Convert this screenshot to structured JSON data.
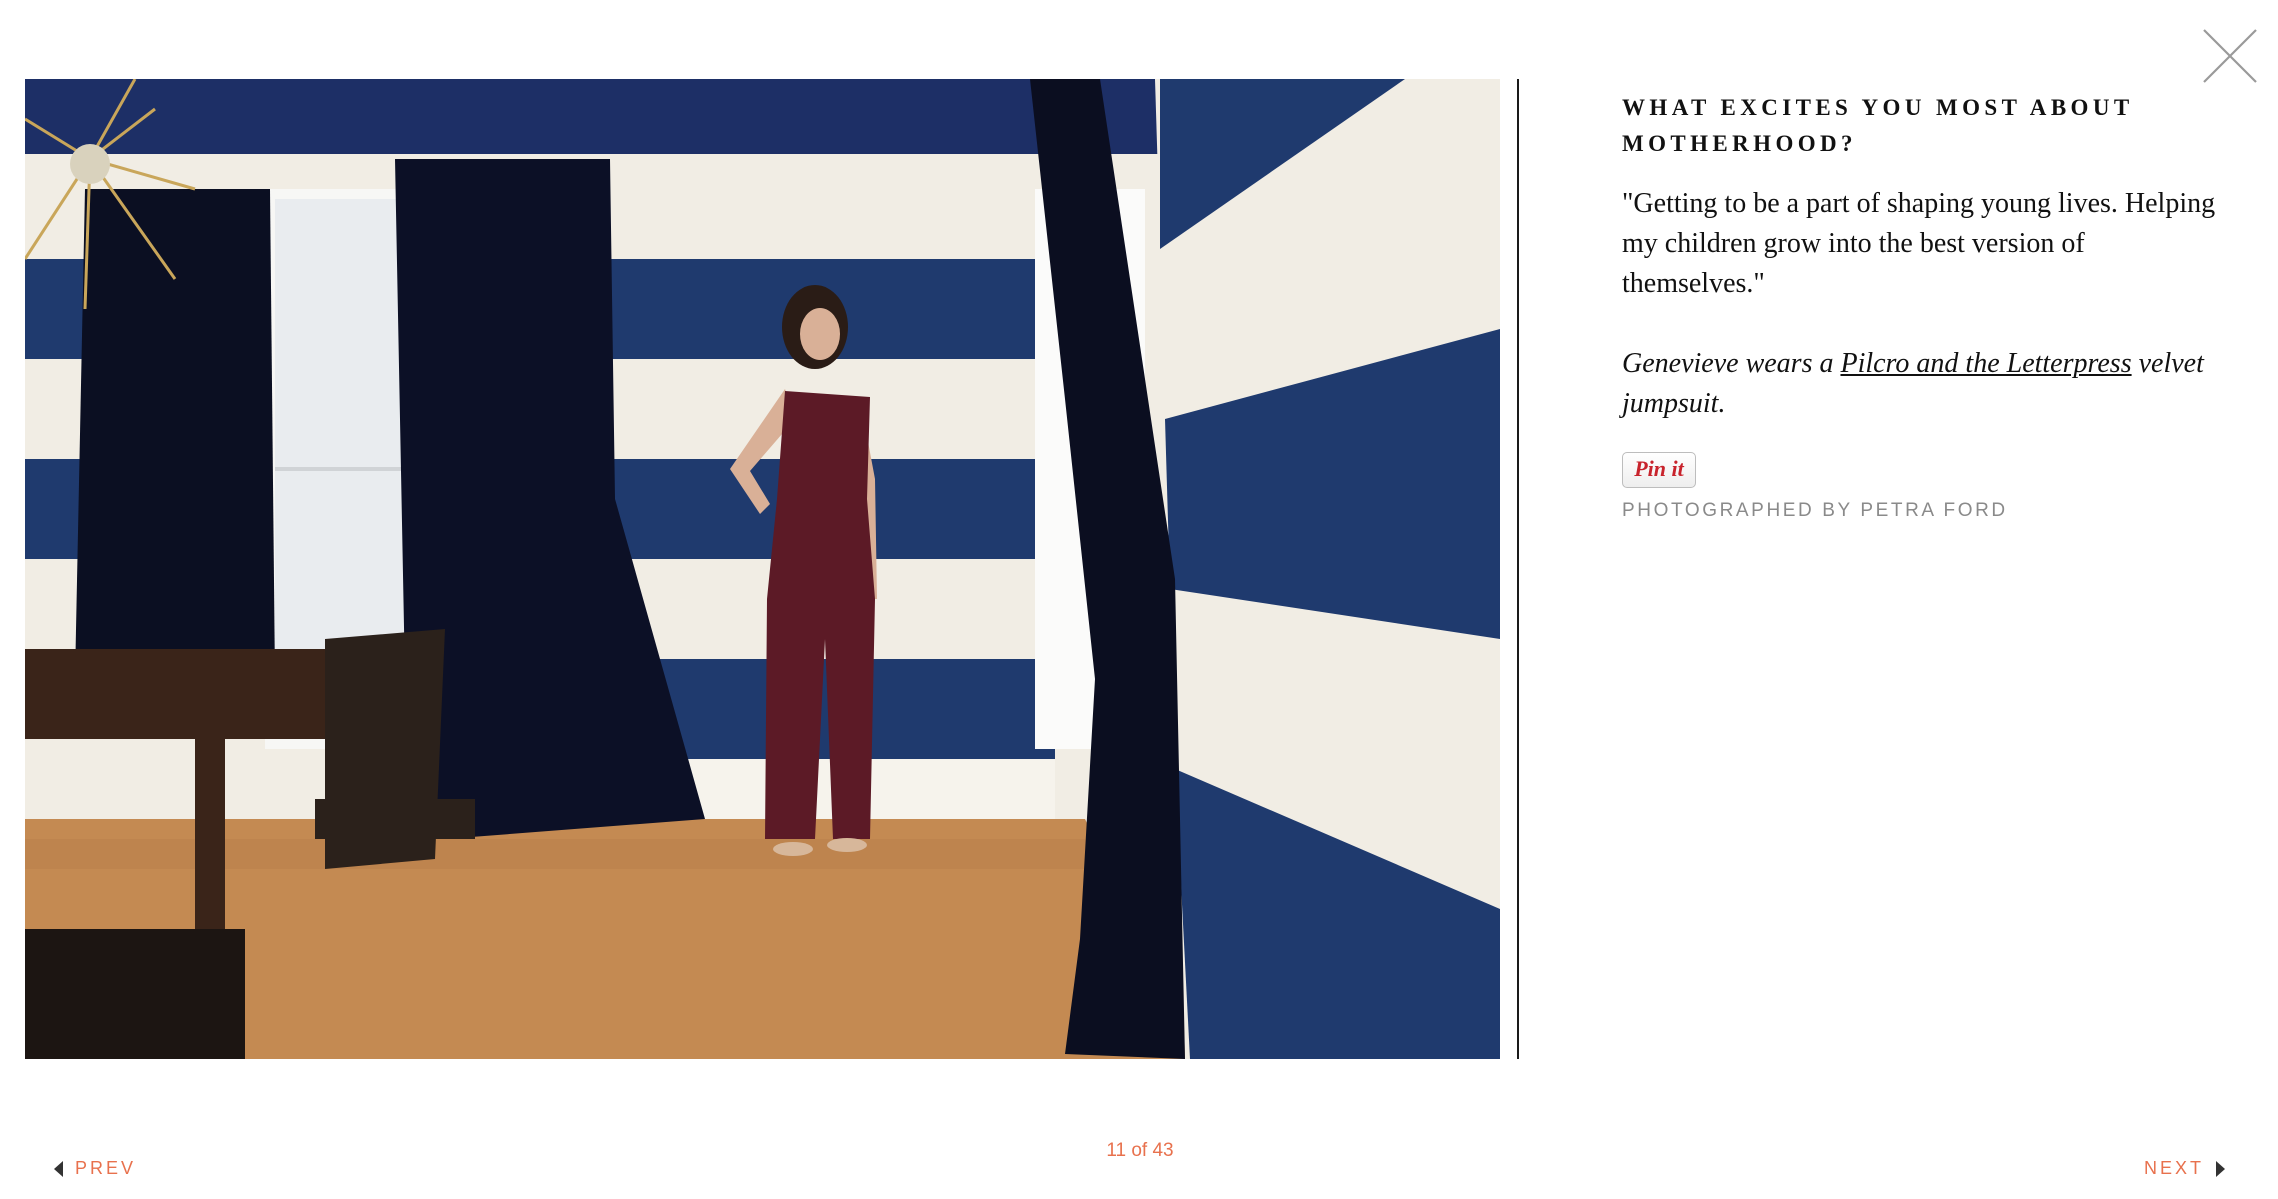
{
  "article": {
    "question": "WHAT EXCITES YOU MOST ABOUT MOTHERHOOD?",
    "answer": "\"Getting to be a part of shaping young lives. Helping my children grow into the best version of themselves.\"",
    "credit_prefix": "Genevieve wears a ",
    "credit_link": "Pilcro and the Letterpress",
    "credit_suffix": "velvet jumpsuit.",
    "photographer": "PHOTOGRAPHED BY PETRA FORD"
  },
  "pin_button": {
    "label": "Pin it"
  },
  "pagination": {
    "counter": "11 of 43",
    "prev_label": "PREV",
    "next_label": "NEXT"
  },
  "colors": {
    "accent": "#e8714d",
    "navy_stripe": "#1f3a6e",
    "cream_stripe": "#f1ede4",
    "jumpsuit": "#5c1a26",
    "pin_red": "#c8232c"
  },
  "icons": {
    "close": "close-icon",
    "prev": "caret-left-icon",
    "next": "caret-right-icon"
  }
}
